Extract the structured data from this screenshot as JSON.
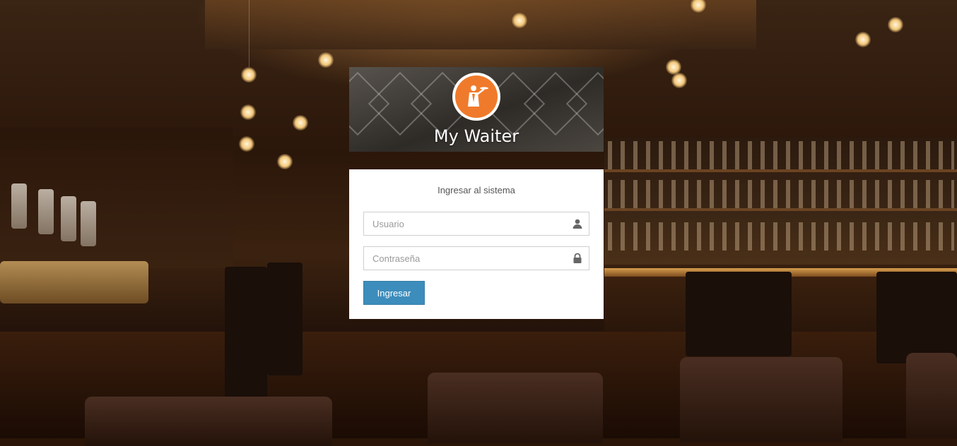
{
  "app": {
    "title": "My Waiter",
    "logo_icon": "waiter-logo-icon"
  },
  "login": {
    "message": "Ingresar al sistema",
    "username_placeholder": "Usuario",
    "username_value": "",
    "username_icon": "user-icon",
    "password_placeholder": "Contraseña",
    "password_value": "",
    "password_icon": "lock-icon",
    "submit_label": "Ingresar"
  },
  "colors": {
    "primary_button": "#3c8dbc",
    "logo_orange": "#f07a2b",
    "panel_background": "#ffffff"
  }
}
